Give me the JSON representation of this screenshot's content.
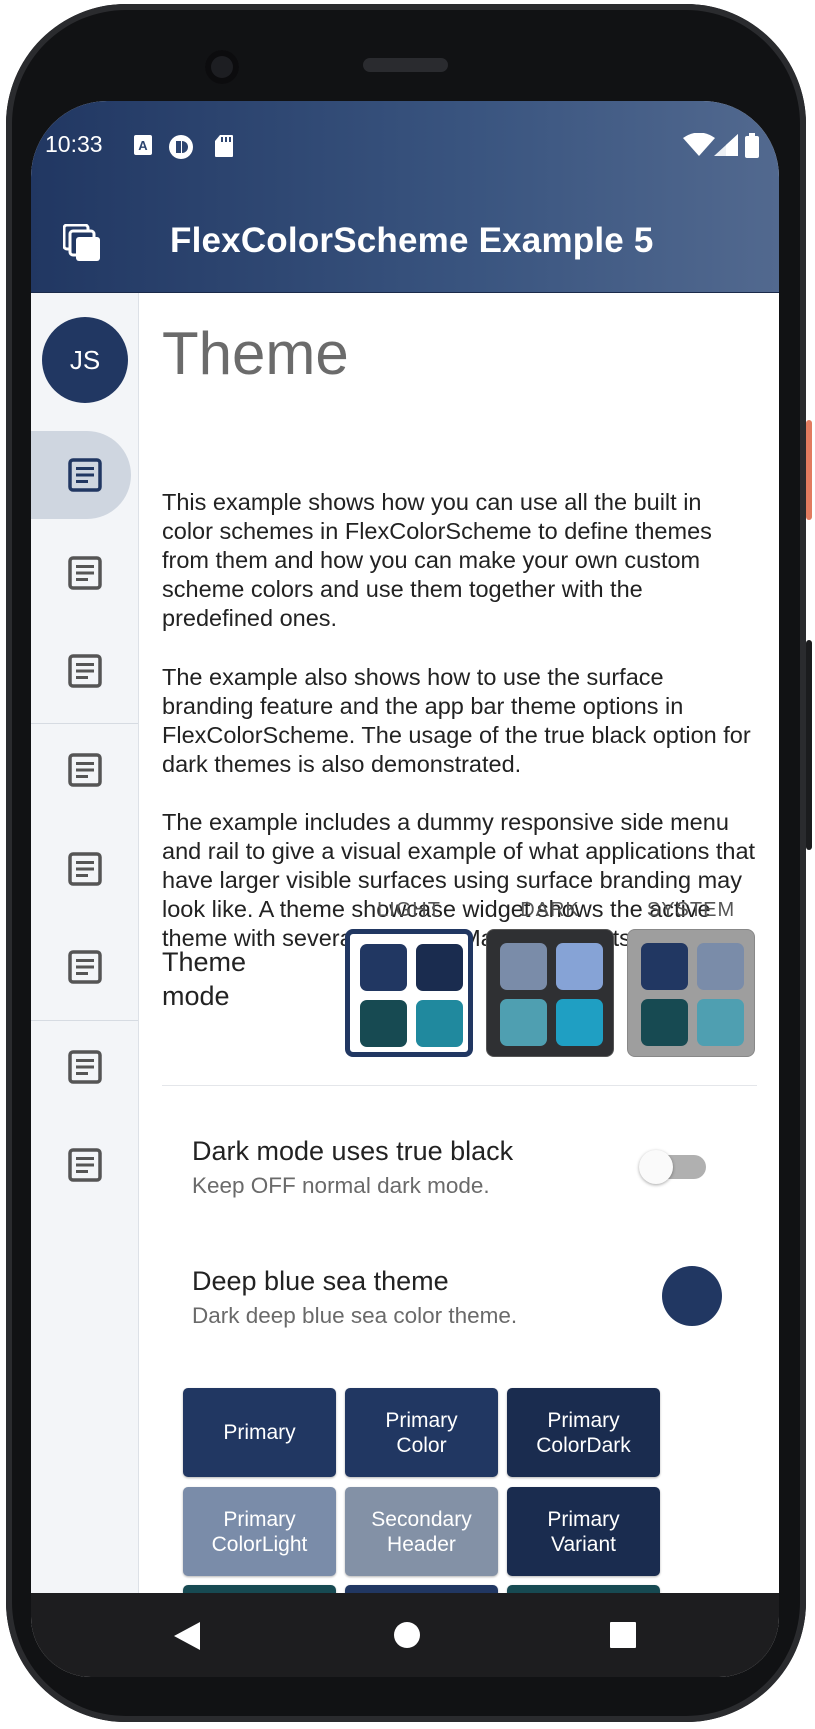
{
  "colors": {
    "primary": "#213762",
    "primary_dark": "#1a2c4f",
    "primary_light": "#7a8ca9",
    "secondary_header": "#8391a6",
    "teal_dark": "#174a52",
    "teal": "#20899e"
  },
  "status_bar": {
    "time": "10:33",
    "left_icons": [
      "translate-icon",
      "nfc-icon",
      "sd-card-icon"
    ],
    "right_icons": [
      "wifi-icon",
      "cell-signal-icon",
      "battery-icon"
    ]
  },
  "app_bar": {
    "title": "FlexColorScheme Example 5",
    "menu_icon": "layers-icon"
  },
  "rail": {
    "avatar_initials": "JS",
    "items": [
      {
        "icon": "article-icon",
        "selected": true
      },
      {
        "icon": "article-icon",
        "selected": false
      },
      {
        "icon": "article-icon",
        "selected": false
      },
      {
        "icon": "article-icon",
        "selected": false
      },
      {
        "icon": "article-icon",
        "selected": false
      },
      {
        "icon": "article-icon",
        "selected": false
      },
      {
        "icon": "article-icon",
        "selected": false
      },
      {
        "icon": "article-icon",
        "selected": false
      }
    ]
  },
  "main": {
    "title": "Theme",
    "paragraphs": [
      "This example shows how you can use all the built in color schemes in FlexColorScheme to define themes from them and how you can make your own custom scheme colors and use them together with the predefined ones.",
      "The example also shows how to use the surface branding feature and the app bar theme options in FlexColorScheme. The usage of the true black option for dark themes is also demonstrated.",
      "The example includes a dummy responsive side menu and rail to give a visual example of what applications that have larger visible surfaces using surface branding may look like. A theme showcase widget shows the active theme with several common Material widgets."
    ],
    "theme_mode": {
      "label": "Theme mode",
      "options": [
        {
          "header": "LIGHT",
          "selected": true,
          "swatches": [
            "#213762",
            "#1a2c4f",
            "#174a52",
            "#20899e"
          ],
          "bg": "#ffffff"
        },
        {
          "header": "DARK",
          "selected": false,
          "swatches": [
            "#7a8ca9",
            "#86a3d6",
            "#4f9fb1",
            "#1f9fc3"
          ],
          "bg": "#2f3033"
        },
        {
          "header": "SYSTEM",
          "selected": false,
          "swatches": [
            "#213762",
            "#7a8ca9",
            "#174a52",
            "#4f9fb1"
          ],
          "bg": "#9e9e9e"
        }
      ]
    },
    "settings": [
      {
        "title": "Dark mode uses true black",
        "subtitle": "Keep OFF normal dark mode.",
        "control": "switch",
        "value": false
      },
      {
        "title": "Deep blue sea theme",
        "subtitle": "Dark deep blue sea color theme.",
        "control": "color-indicator"
      }
    ],
    "color_boxes": [
      {
        "label": "Primary",
        "color": "#213762"
      },
      {
        "label": "Primary Color",
        "color": "#213762"
      },
      {
        "label": "Primary ColorDark",
        "color": "#1a2c4f"
      },
      {
        "label": "Primary ColorLight",
        "color": "#7a8ca9"
      },
      {
        "label": "Secondary Header",
        "color": "#8391a6"
      },
      {
        "label": "Primary Variant",
        "color": "#1a2c4f"
      }
    ]
  },
  "nav_bar": {
    "buttons": [
      "back-icon",
      "home-icon",
      "recents-icon"
    ]
  }
}
